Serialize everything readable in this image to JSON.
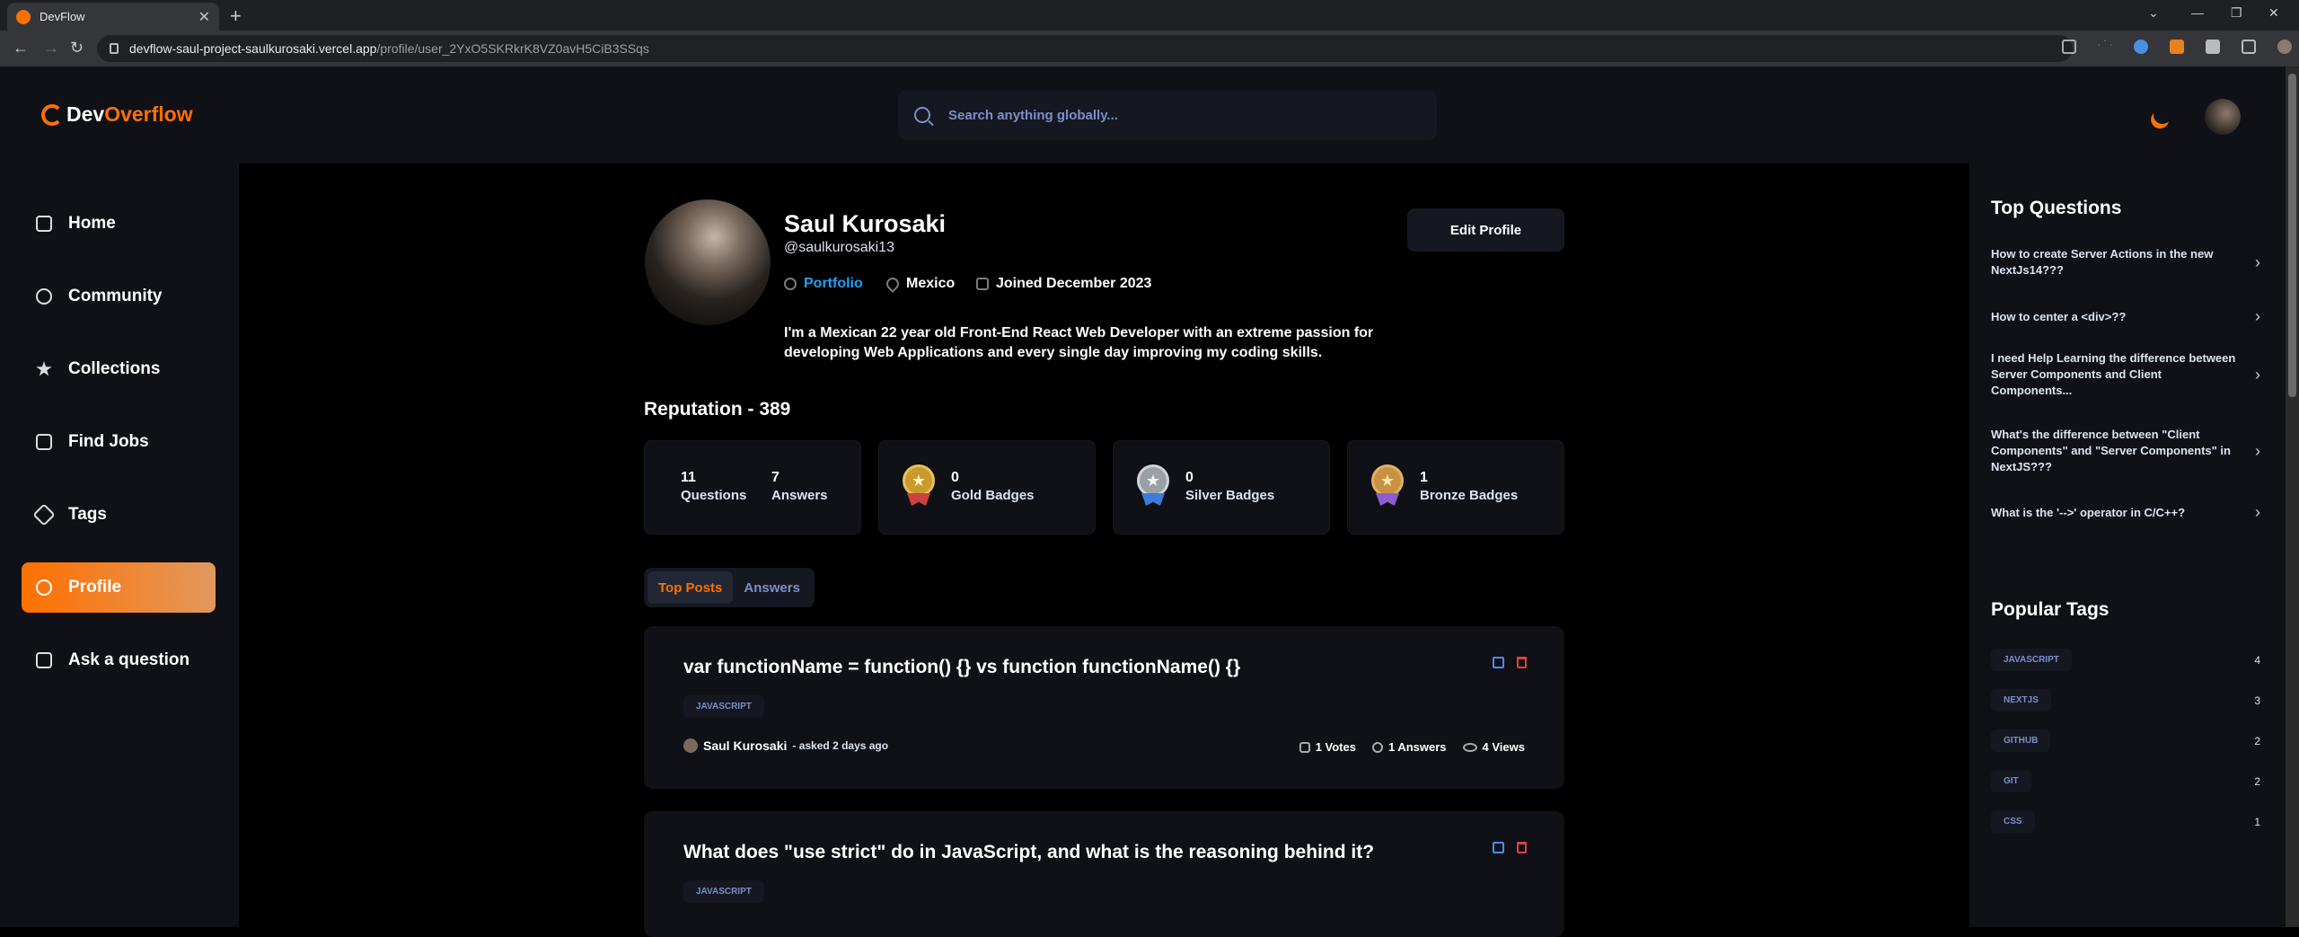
{
  "browser": {
    "tab_title": "DevFlow",
    "url_host": "devflow-saul-project-saulkurosaki.vercel.app",
    "url_path": "/profile/user_2YxO5SKRkrK8VZ0avH5CiB3SSqs"
  },
  "navbar": {
    "logo_dev": "Dev",
    "logo_overflow": "Overflow",
    "search_placeholder": "Search anything globally..."
  },
  "sidebar": {
    "items": [
      {
        "label": "Home",
        "icon": "home-icon"
      },
      {
        "label": "Community",
        "icon": "users-icon"
      },
      {
        "label": "Collections",
        "icon": "star-icon"
      },
      {
        "label": "Find Jobs",
        "icon": "suitcase-icon"
      },
      {
        "label": "Tags",
        "icon": "tag-icon"
      },
      {
        "label": "Profile",
        "icon": "user-icon",
        "active": true
      },
      {
        "label": "Ask a question",
        "icon": "question-icon"
      }
    ]
  },
  "profile": {
    "name": "Saul Kurosaki",
    "handle": "@saulkurosaki13",
    "portfolio": "Portfolio",
    "location": "Mexico",
    "joined": "Joined December 2023",
    "edit_label": "Edit Profile",
    "bio": "I'm a Mexican 22 year old Front-End React Web Developer with an extreme passion for developing Web Applications and every single day improving my coding skills.",
    "reputation": "Reputation - 389"
  },
  "stats": {
    "questions_count": "11",
    "questions_label": "Questions",
    "answers_count": "7",
    "answers_label": "Answers",
    "gold_count": "0",
    "gold_label": "Gold Badges",
    "silver_count": "0",
    "silver_label": "Silver Badges",
    "bronze_count": "1",
    "bronze_label": "Bronze Badges"
  },
  "tabs": {
    "top_posts": "Top Posts",
    "answers": "Answers"
  },
  "posts": [
    {
      "title": "var functionName = function() {} vs function functionName() {}",
      "tag": "JAVASCRIPT",
      "author": "Saul Kurosaki",
      "asked": "- asked 2 days ago",
      "votes": "1 Votes",
      "answers": "1 Answers",
      "views": "4 Views"
    },
    {
      "title": "What does \"use strict\" do in JavaScript, and what is the reasoning behind it?",
      "tag": "JAVASCRIPT"
    }
  ],
  "right": {
    "top_questions_title": "Top Questions",
    "questions": [
      "How to create Server Actions in the new NextJs14???",
      "How to center a <div>??",
      "I need Help Learning the difference between Server Components and Client Components...",
      "What's the difference between \"Client Components\" and \"Server Components\" in NextJS???",
      "What is the '-->' operator in C/C++?"
    ],
    "popular_tags_title": "Popular Tags",
    "tags": [
      {
        "name": "JAVASCRIPT",
        "count": "4"
      },
      {
        "name": "NEXTJS",
        "count": "3"
      },
      {
        "name": "GITHUB",
        "count": "2"
      },
      {
        "name": "GIT",
        "count": "2"
      },
      {
        "name": "CSS",
        "count": "1"
      }
    ]
  },
  "colors": {
    "accent": "#ff7000",
    "link": "#1da1f2",
    "tag_text": "#7b8ec8",
    "background": "#000000",
    "panel": "#0f1117"
  }
}
